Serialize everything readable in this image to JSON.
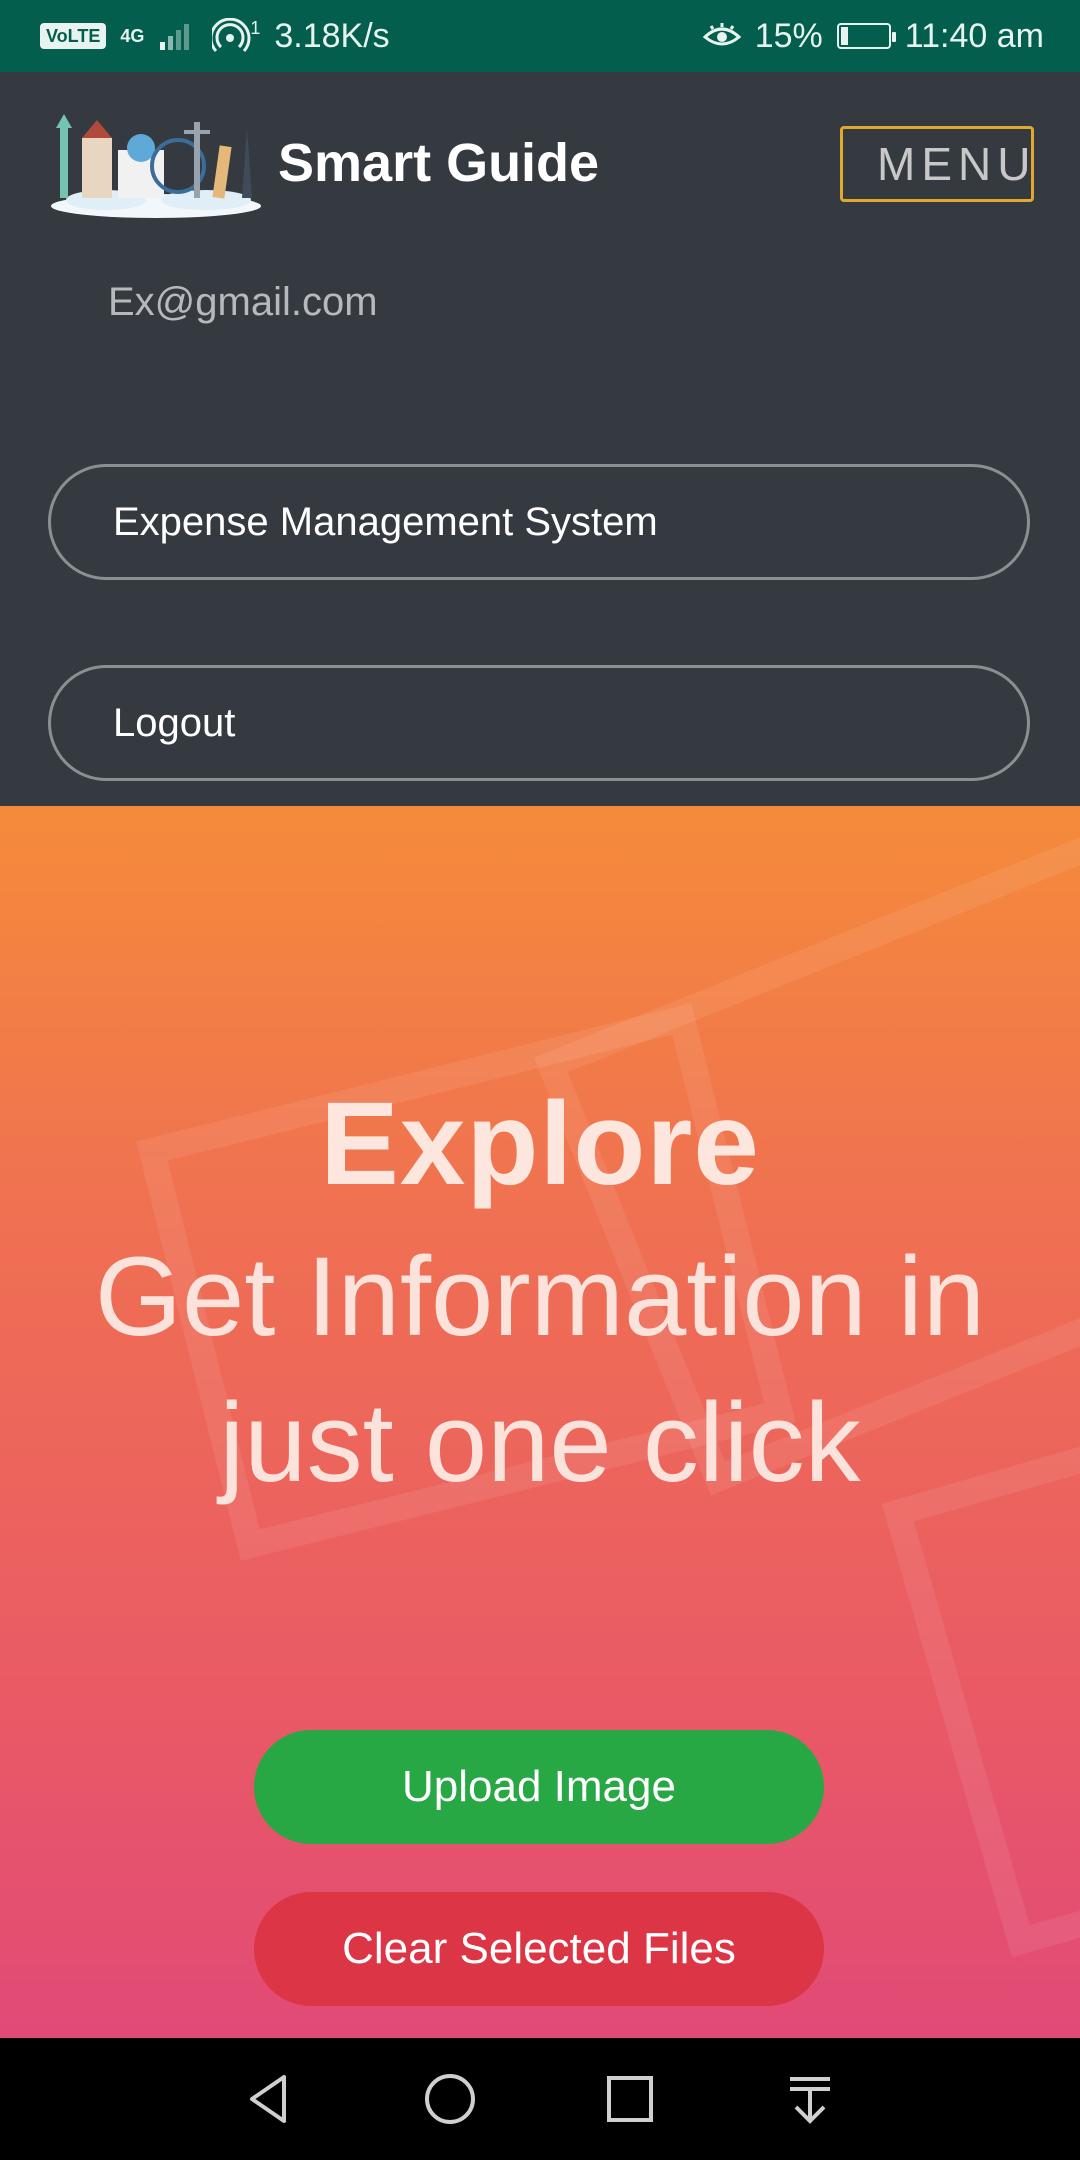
{
  "status_bar": {
    "volte": "VoLTE",
    "network": "4G",
    "hotspot_count": "1",
    "speed": "3.18K/s",
    "battery_percent": "15%",
    "battery_level": 0.15,
    "time": "11:40 am"
  },
  "header": {
    "brand_name": "Smart Guide",
    "menu_label": "MENU",
    "email": "Ex@gmail.com",
    "nav_items": [
      {
        "label": "Expense Management System"
      },
      {
        "label": "Logout"
      }
    ]
  },
  "hero": {
    "title": "Explore",
    "subtitle": "Get Information in just one click",
    "buttons": {
      "upload": "Upload Image",
      "clear": "Clear Selected Files"
    }
  },
  "colors": {
    "status_bar": "#035e4e",
    "navbar": "#343a40",
    "menu_border": "#e0a82e",
    "upload_button": "#28a745",
    "clear_button": "#dc3545"
  },
  "icons": {
    "nav_back": "triangle-back-icon",
    "nav_home": "circle-home-icon",
    "nav_recent": "square-recent-icon",
    "nav_notifications": "pull-down-icon"
  }
}
